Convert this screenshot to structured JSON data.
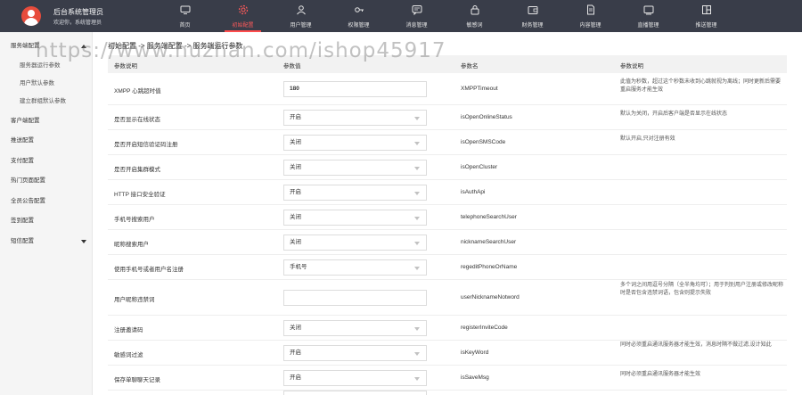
{
  "brand": {
    "title": "后台系统管理员",
    "subtitle": "欢迎你，系统管理员",
    "avatar_icon": "user-avatar-icon",
    "avatar_color": "#e74c3c"
  },
  "nav": {
    "items": [
      {
        "label": "首页",
        "icon": "monitor-icon"
      },
      {
        "label": "初始配置",
        "icon": "gear-icon",
        "active": true
      },
      {
        "label": "用户管理",
        "icon": "user-icon"
      },
      {
        "label": "权限管理",
        "icon": "key-icon"
      },
      {
        "label": "消息管理",
        "icon": "message-icon"
      },
      {
        "label": "敏感词",
        "icon": "lock-icon"
      },
      {
        "label": "财务管理",
        "icon": "wallet-icon"
      },
      {
        "label": "内容管理",
        "icon": "document-icon"
      },
      {
        "label": "直播管理",
        "icon": "live-icon"
      },
      {
        "label": "推送管理",
        "icon": "push-icon"
      }
    ],
    "active_color": "#ff4d4d"
  },
  "sidebar": {
    "items": [
      {
        "label": "服务端配置",
        "expanded": true
      },
      {
        "label": "服务器运行参数",
        "sub": true
      },
      {
        "label": "用户默认参数",
        "sub": true
      },
      {
        "label": "建立群组默认参数",
        "sub": true
      },
      {
        "label": "客户端配置"
      },
      {
        "label": "推送配置"
      },
      {
        "label": "支付配置"
      },
      {
        "label": "热门页面配置"
      },
      {
        "label": "全员公告配置"
      },
      {
        "label": "签到配置"
      },
      {
        "label": "短信配置",
        "collapsed": true
      }
    ]
  },
  "main": {
    "breadcrumb": "初始配置 -> 服务端配置 -> 服务端运行参数",
    "headers": {
      "name": "参数说明",
      "value": "参数值",
      "key": "参数名",
      "desc": "参数说明"
    },
    "rows": [
      {
        "name": "XMPP 心跳超时值",
        "type": "input",
        "value": "180",
        "key": "XMPPTimeout",
        "desc": "此值为秒数，超过这个秒数未收到心跳就视为离线；同时更新后需要重启服务才能生效"
      },
      {
        "name": "是否显示在线状态",
        "type": "select",
        "value": "开启",
        "key": "isOpenOnlineStatus",
        "desc": "默认为关闭，开启后客户端是否显示在线状态"
      },
      {
        "name": "是否开启短信验证码注册",
        "type": "select",
        "value": "关闭",
        "key": "isOpenSMSCode",
        "desc": "默认开启,只对注册有效"
      },
      {
        "name": "是否开启集群模式",
        "type": "select",
        "value": "关闭",
        "key": "isOpenCluster",
        "desc": ""
      },
      {
        "name": "HTTP 接口安全验证",
        "type": "select",
        "value": "开启",
        "key": "isAuthApi",
        "desc": ""
      },
      {
        "name": "手机号搜索用户",
        "type": "select",
        "value": "关闭",
        "key": "telephoneSearchUser",
        "desc": ""
      },
      {
        "name": "昵称搜索用户",
        "type": "select",
        "value": "关闭",
        "key": "nicknameSearchUser",
        "desc": ""
      },
      {
        "name": "使用手机号或者用户名注册",
        "type": "select",
        "value": "手机号",
        "key": "regeditPhoneOrName",
        "desc": ""
      },
      {
        "name": "用户昵称违禁词",
        "type": "input",
        "value": "",
        "key": "userNicknameNotword",
        "desc": "多个词之间用逗号分隔（全半角均可）；用于判别用户注册或修改昵称时是否包含违禁词语，包含则提示失败"
      },
      {
        "name": "注册邀请码",
        "type": "select",
        "value": "关闭",
        "key": "registerInviteCode",
        "desc": ""
      },
      {
        "name": "敏感词过滤",
        "type": "select",
        "value": "开启",
        "key": "isKeyWord",
        "desc": "同时必须重启通讯服务器才能生效，消息时隔不做过滤,设计知此"
      },
      {
        "name": "保存单聊聊天记录",
        "type": "select",
        "value": "开启",
        "key": "isSaveMsg",
        "desc": "同时必须重启通讯服务器才能生效"
      }
    ]
  },
  "watermark": "https://www.huzhan.com/ishop45917"
}
